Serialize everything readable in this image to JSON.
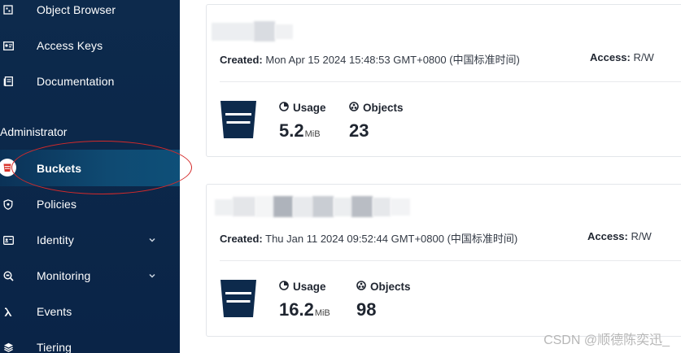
{
  "sidebar": {
    "items_top": [
      {
        "label": "Object Browser",
        "icon": "object-browser-icon"
      },
      {
        "label": "Access Keys",
        "icon": "access-keys-icon"
      },
      {
        "label": "Documentation",
        "icon": "documentation-icon"
      }
    ],
    "section_header": "Administrator",
    "items_admin": [
      {
        "label": "Buckets",
        "icon": "bucket-icon",
        "active": true
      },
      {
        "label": "Policies",
        "icon": "shield-icon"
      },
      {
        "label": "Identity",
        "icon": "identity-icon",
        "expandable": true
      },
      {
        "label": "Monitoring",
        "icon": "monitoring-icon",
        "expandable": true
      },
      {
        "label": "Events",
        "icon": "lambda-icon"
      },
      {
        "label": "Tiering",
        "icon": "layers-icon"
      }
    ]
  },
  "buckets": [
    {
      "created_label": "Created:",
      "created_value": "Mon Apr 15 2024 15:48:53 GMT+0800 (中国标准时间)",
      "access_label": "Access:",
      "access_value": "R/W",
      "usage_label": "Usage",
      "usage_value": "5.2",
      "usage_unit": "MiB",
      "objects_label": "Objects",
      "objects_value": "23"
    },
    {
      "created_label": "Created:",
      "created_value": "Thu Jan 11 2024 09:52:44 GMT+0800 (中国标准时间)",
      "access_label": "Access:",
      "access_value": "R/W",
      "usage_label": "Usage",
      "usage_value": "16.2",
      "usage_unit": "MiB",
      "objects_label": "Objects",
      "objects_value": "98"
    }
  ],
  "watermark": "CSDN @顺德陈奕迅_",
  "colors": {
    "sidebar_bg": "#0d2a4c",
    "active_bg": "#0f4a72",
    "highlight_ring": "#d42a2a",
    "bucket_icon": "#0d2a4c"
  }
}
